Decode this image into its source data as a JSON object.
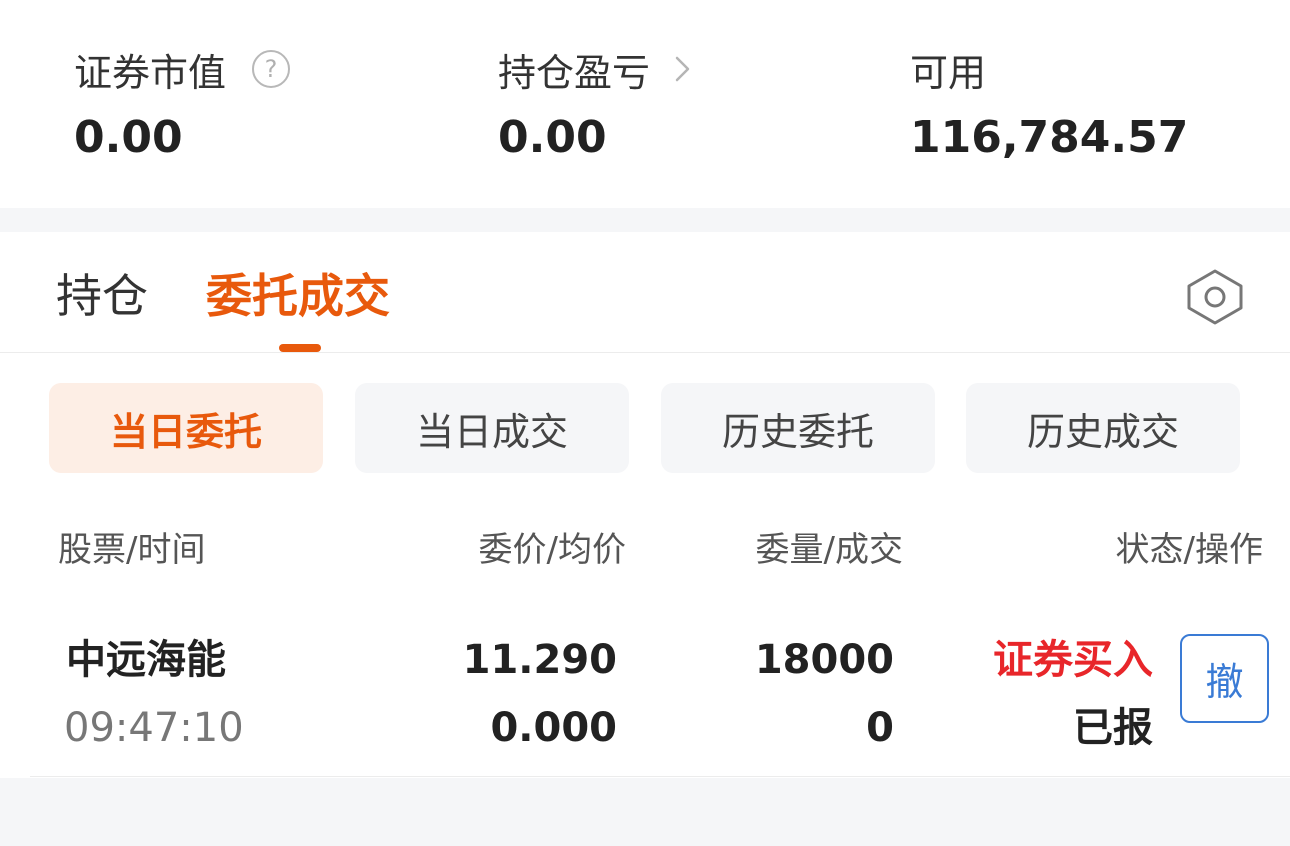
{
  "summary": {
    "market_value": {
      "label": "证券市值",
      "value": "0.00",
      "icon": "help-circle-icon"
    },
    "position_pnl": {
      "label": "持仓盈亏",
      "value": "0.00",
      "icon": "chevron-right-icon"
    },
    "available": {
      "label": "可用",
      "value": "116,784.57"
    }
  },
  "tabs": {
    "positions": "持仓",
    "orders": "委托成交",
    "settings_icon": "gear-icon"
  },
  "filters": {
    "today_orders": "当日委托",
    "today_trades": "当日成交",
    "history_orders": "历史委托",
    "history_trades": "历史成交"
  },
  "table": {
    "headers": {
      "stock_time": "股票/时间",
      "price": "委价/均价",
      "qty": "委量/成交",
      "status_action": "状态/操作"
    },
    "rows": [
      {
        "name": "中远海能",
        "time": "09:47:10",
        "order_price": "11.290",
        "avg_price": "0.000",
        "order_qty": "18000",
        "filled_qty": "0",
        "side": "证券买入",
        "status": "已报",
        "action": "撤"
      }
    ]
  },
  "colors": {
    "accent": "#e8590c",
    "buy": "#e8262a",
    "link": "#3a7bd5"
  }
}
